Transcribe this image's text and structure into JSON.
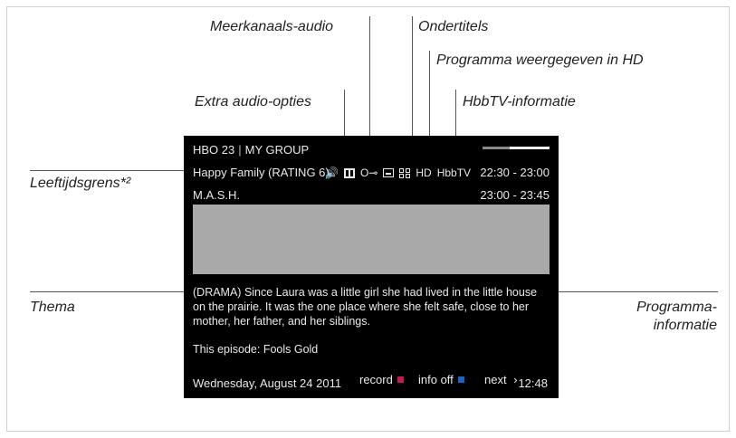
{
  "callouts": {
    "multichannel_audio": "Meerkanaals-audio",
    "subtitles": "Ondertitels",
    "hd_program": "Programma weergegeven in HD",
    "extra_audio": "Extra audio-opties",
    "hbbtv_info": "HbbTV-informatie",
    "age_limit": "Leeftijdsgrens*²",
    "theme": "Thema",
    "program_info_line1": "Programma-",
    "program_info_line2": "informatie"
  },
  "osd": {
    "channel": "HBO 23",
    "separator": "|",
    "group": "MY GROUP",
    "current_program": "Happy Family (RATING 6)",
    "icons": {
      "audio_icon_glyph": "🔊",
      "key_icon_glyph": "O⊸",
      "hd_label": "HD",
      "hbbtv_label": "HbbTV"
    },
    "current_time": "22:30 - 23:00",
    "next_program": "M.A.S.H.",
    "next_time": "23:00 - 23:45",
    "description": "(DRAMA) Since Laura was a little girl she had lived in the little house on the prairie. It was the one place where she felt safe, close to her mother, her father, and her siblings.",
    "episode": "This episode: Fools Gold",
    "date": "Wednesday, August 24 2011",
    "record_label": "record",
    "info_off_label": "info off",
    "next_label": "next",
    "next_arrow": "›",
    "clock": "12:48",
    "colors": {
      "record": "#c8185a",
      "info_off": "#1a63c8"
    }
  }
}
